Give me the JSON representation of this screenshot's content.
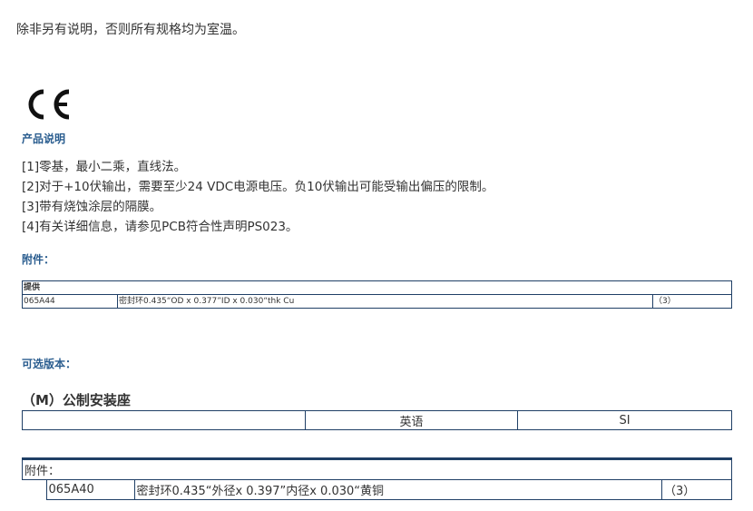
{
  "intro_text": "除非另有说明，否则所有规格均为室温。",
  "ce_mark_label": "CE",
  "product_desc_heading": "产品说明",
  "notes": [
    "[1]零基，最小二乘，直线法。",
    "[2]对于+10伏输出，需要至少24 VDC电源电压。负10伏输出可能受输出偏压的限制。",
    "[3]带有烧蚀涂层的隔膜。",
    "[4]有关详细信息，请参见PCB符合性声明PS023。"
  ],
  "accessories_heading": "附件：",
  "supplied_table": {
    "header": "提供",
    "rows": [
      {
        "part": "065A44",
        "description": "密封环0.435“OD x 0.377”ID x 0.030“thk Cu",
        "qty": "（3）"
      }
    ]
  },
  "optional_versions_heading": "可选版本：",
  "metric_mount": {
    "title": "（M）公制安装座",
    "columns": [
      "",
      "英语",
      "SI"
    ]
  },
  "metric_accessories": {
    "label": "附件：",
    "rows": [
      {
        "part": "065A40",
        "description": "密封环0.435“外径x 0.397”内径x 0.030“黄铜",
        "qty": "（3）"
      }
    ]
  }
}
